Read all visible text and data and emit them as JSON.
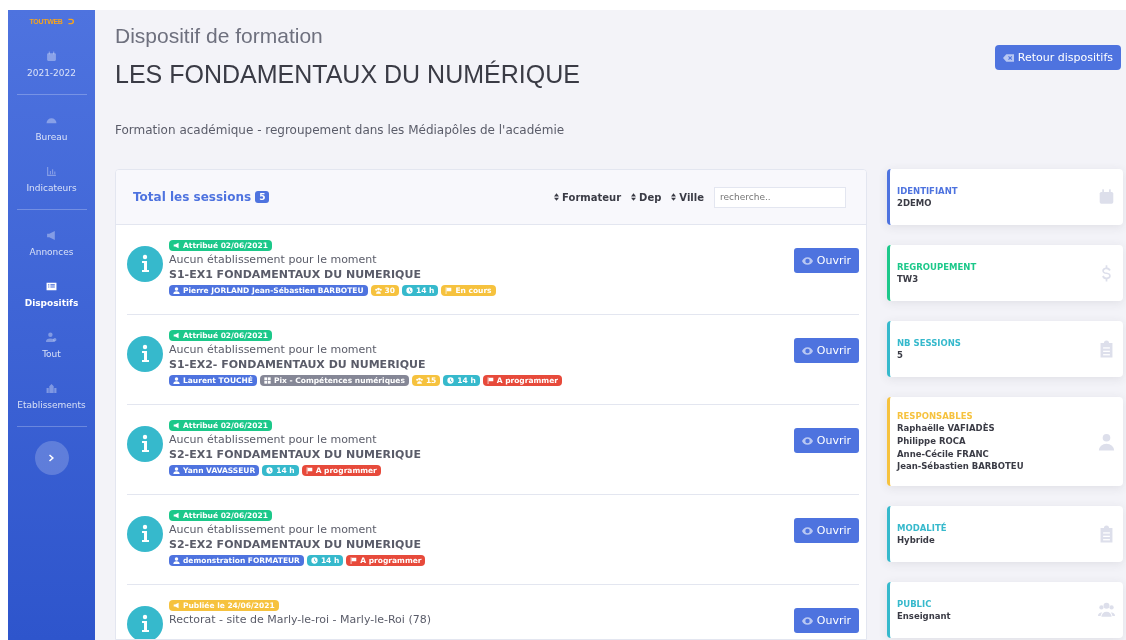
{
  "sidebar": {
    "logo": "TOUTWEB",
    "groups": [
      [
        {
          "kind": "calendar",
          "label": "2021-2022",
          "selected": false
        }
      ],
      [
        {
          "kind": "gauge",
          "label": "Bureau",
          "selected": false
        },
        {
          "kind": "chart",
          "label": "Indicateurs",
          "selected": false
        }
      ],
      [
        {
          "kind": "megaphone",
          "label": "Annonces",
          "selected": false
        },
        {
          "kind": "list",
          "label": "Dispositifs",
          "selected": true
        },
        {
          "kind": "user",
          "label": "Tout",
          "selected": false
        },
        {
          "kind": "building",
          "label": "Etablissements",
          "selected": false
        }
      ]
    ]
  },
  "header": {
    "kicker": "Dispositif de formation",
    "title": "LES FONDAMENTAUX DU NUMÉRIQUE",
    "back_button": "Retour dispositifs",
    "subtitle": "Formation académique - regroupement dans les Médiapôles de l'académie"
  },
  "sessions_panel": {
    "title": "Total les sessions",
    "count": "5",
    "sorts": [
      "Formateur",
      "Dep",
      "Ville"
    ],
    "search_placeholder": "recherche..",
    "sessions": [
      {
        "status": {
          "text": "Attribué 02/06/2021",
          "color": "#1cc88a"
        },
        "place": "Aucun établissement pour le moment",
        "title": "S1-EX1 FONDAMENTAUX DU NUMERIQUE",
        "button": "Ouvrir",
        "tags": [
          {
            "kind": "person",
            "text": "Pierre JORLAND Jean-Sébastien BARBOTEU",
            "color": "#4e73df"
          },
          {
            "kind": "people",
            "text": "30",
            "color": "#f6c23e"
          },
          {
            "kind": "hours",
            "text": "14 h",
            "color": "#36b9cc"
          },
          {
            "kind": "flag",
            "text": "En cours",
            "color": "#f6c23e"
          }
        ]
      },
      {
        "status": {
          "text": "Attribué 02/06/2021",
          "color": "#1cc88a"
        },
        "place": "Aucun établissement pour le moment",
        "title": "S1-EX2- FONDAMENTAUX DU NUMERIQUE",
        "button": "Ouvrir",
        "tags": [
          {
            "kind": "person",
            "text": "Laurent TOUCHÉ",
            "color": "#4e73df"
          },
          {
            "kind": "module",
            "text": "Pix - Compétences numériques",
            "color": "#858796"
          },
          {
            "kind": "people",
            "text": "15",
            "color": "#f6c23e"
          },
          {
            "kind": "hours",
            "text": "14 h",
            "color": "#36b9cc"
          },
          {
            "kind": "flag",
            "text": "A programmer",
            "color": "#e74a3b"
          }
        ]
      },
      {
        "status": {
          "text": "Attribué 02/06/2021",
          "color": "#1cc88a"
        },
        "place": "Aucun établissement pour le moment",
        "title": "S2-EX1 FONDAMENTAUX DU NUMERIQUE",
        "button": "Ouvrir",
        "tags": [
          {
            "kind": "person",
            "text": "Yann VAVASSEUR",
            "color": "#4e73df"
          },
          {
            "kind": "hours",
            "text": "14 h",
            "color": "#36b9cc"
          },
          {
            "kind": "flag",
            "text": "A programmer",
            "color": "#e74a3b"
          }
        ]
      },
      {
        "status": {
          "text": "Attribué 02/06/2021",
          "color": "#1cc88a"
        },
        "place": "Aucun établissement pour le moment",
        "title": "S2-EX2 FONDAMENTAUX DU NUMERIQUE",
        "button": "Ouvrir",
        "tags": [
          {
            "kind": "person",
            "text": "demonstration FORMATEUR",
            "color": "#4e73df"
          },
          {
            "kind": "hours",
            "text": "14 h",
            "color": "#36b9cc"
          },
          {
            "kind": "flag",
            "text": "A programmer",
            "color": "#e74a3b"
          }
        ]
      },
      {
        "status": {
          "text": "Publiée le 24/06/2021",
          "color": "#f6c23e"
        },
        "place": "Rectorat - site de Marly-le-roi - Marly-le-Roi (78)",
        "button": "Ouvrir"
      }
    ]
  },
  "info_cards": [
    {
      "label": "IDENTIFIANT",
      "values": [
        "2DEMO"
      ],
      "color": "#4e73df",
      "kind": "calendar"
    },
    {
      "label": "REGROUPEMENT",
      "values": [
        "TW3"
      ],
      "color": "#1cc88a",
      "kind": "dollar"
    },
    {
      "label": "NB SESSIONS",
      "values": [
        "5"
      ],
      "color": "#36b9cc",
      "kind": "clipboard"
    },
    {
      "label": "RESPONSABLES",
      "values": [
        "Raphaëlle VAFIADÈS",
        "Philippe ROCA",
        "Anne-Cécile FRANC",
        "Jean-Sébastien BARBOTEU"
      ],
      "color": "#f6c23e",
      "kind": "manager"
    },
    {
      "label": "MODALITÉ",
      "values": [
        "Hybride"
      ],
      "color": "#36b9cc",
      "kind": "clipboard"
    },
    {
      "label": "PUBLIC",
      "values": [
        "Enseignant"
      ],
      "color": "#36b9cc",
      "kind": "users"
    }
  ]
}
